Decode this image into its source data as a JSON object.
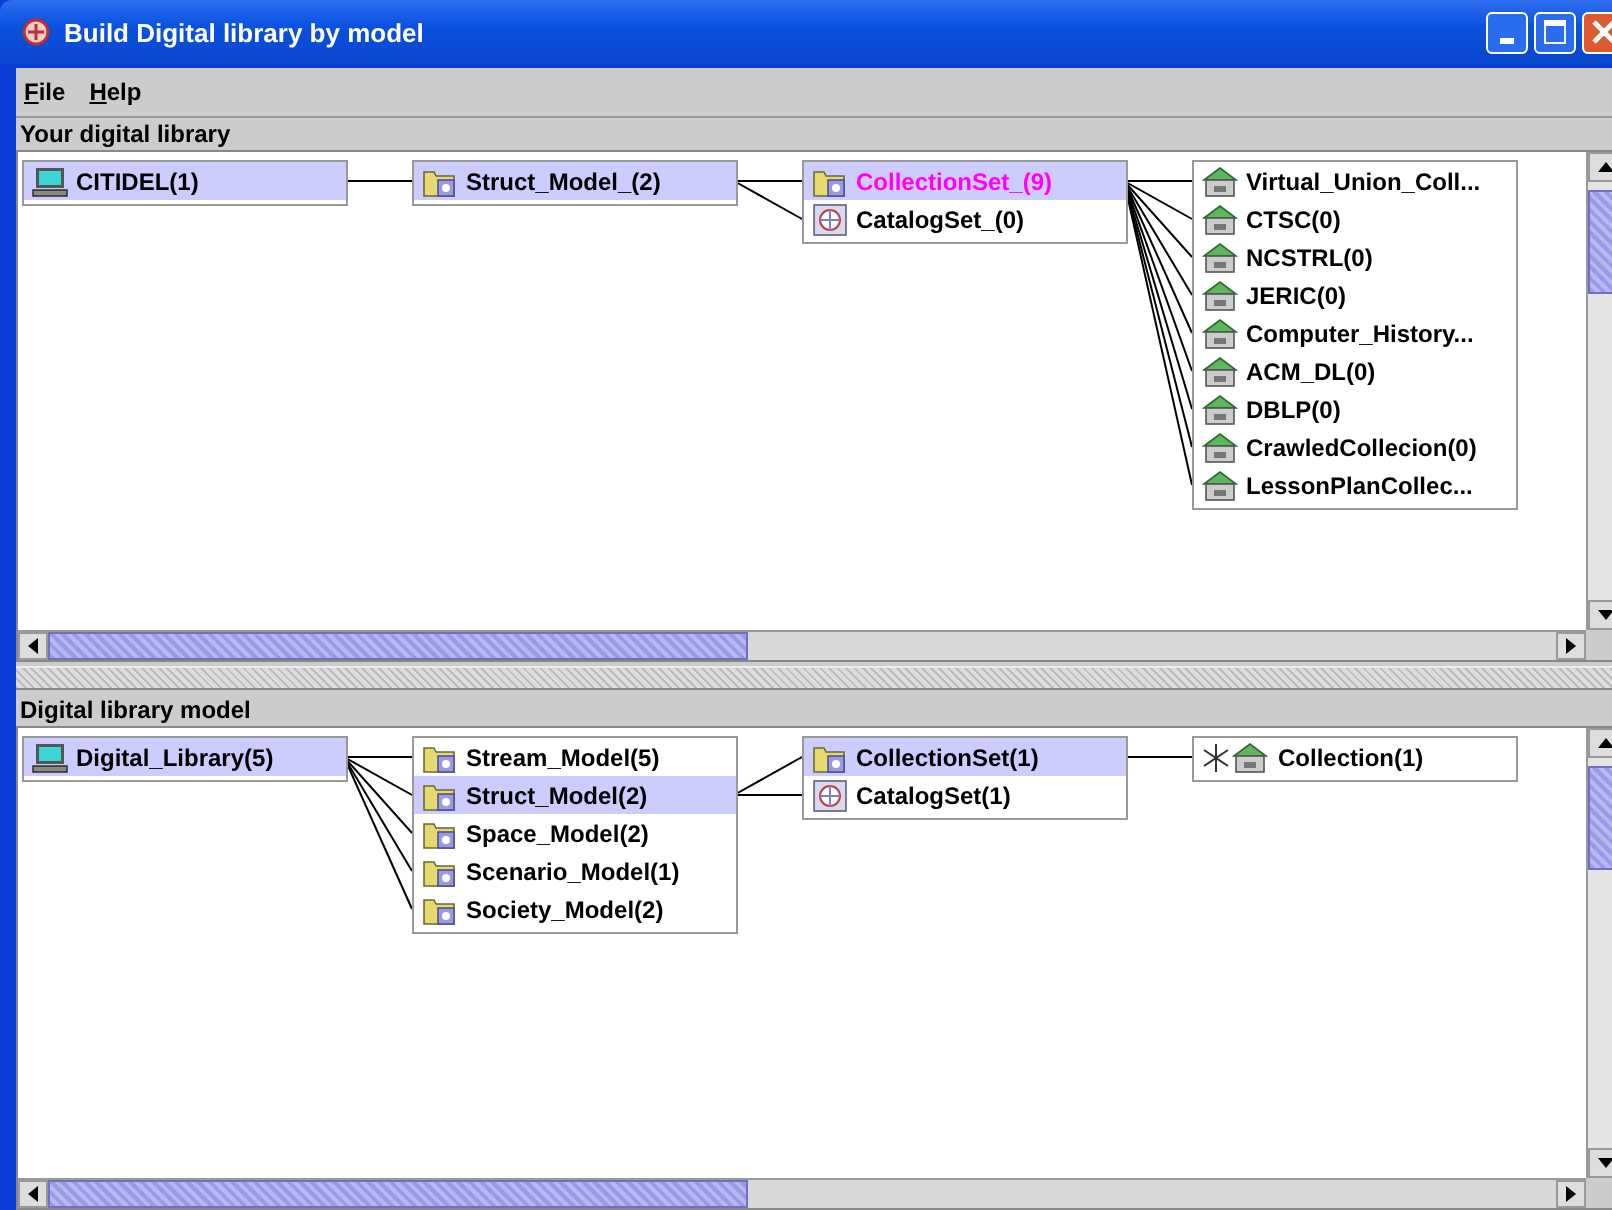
{
  "window": {
    "title": "Build Digital library by model"
  },
  "menu": [
    "File",
    "Help"
  ],
  "panels": [
    {
      "title": "Your digital library",
      "columns": [
        {
          "items": [
            {
              "label": "CITIDEL(1)",
              "kind": "computer",
              "selected": true,
              "marked": false
            }
          ]
        },
        {
          "items": [
            {
              "label": "Struct_Model_(2)",
              "kind": "model",
              "selected": true,
              "marked": false
            }
          ]
        },
        {
          "items": [
            {
              "label": "CollectionSet_(9)",
              "kind": "model",
              "selected": true,
              "marked": true
            },
            {
              "label": "CatalogSet_(0)",
              "kind": "catalog",
              "selected": false,
              "marked": false
            }
          ]
        },
        {
          "items": [
            {
              "label": "Virtual_Union_Coll...",
              "kind": "collection",
              "selected": false,
              "marked": false
            },
            {
              "label": "CTSC(0)",
              "kind": "collection",
              "selected": false,
              "marked": false
            },
            {
              "label": "NCSTRL(0)",
              "kind": "collection",
              "selected": false,
              "marked": false
            },
            {
              "label": "JERIC(0)",
              "kind": "collection",
              "selected": false,
              "marked": false
            },
            {
              "label": "Computer_History...",
              "kind": "collection",
              "selected": false,
              "marked": false
            },
            {
              "label": "ACM_DL(0)",
              "kind": "collection",
              "selected": false,
              "marked": false
            },
            {
              "label": "DBLP(0)",
              "kind": "collection",
              "selected": false,
              "marked": false
            },
            {
              "label": "CrawledCollecion(0)",
              "kind": "collection",
              "selected": false,
              "marked": false
            },
            {
              "label": "LessonPlanCollec...",
              "kind": "collection",
              "selected": false,
              "marked": false
            }
          ]
        }
      ]
    },
    {
      "title": "Digital library model",
      "columns": [
        {
          "items": [
            {
              "label": "Digital_Library(5)",
              "kind": "computer",
              "selected": true,
              "marked": false
            }
          ]
        },
        {
          "items": [
            {
              "label": "Stream_Model(5)",
              "kind": "model",
              "selected": false,
              "marked": false
            },
            {
              "label": "Struct_Model(2)",
              "kind": "model",
              "selected": true,
              "marked": false
            },
            {
              "label": "Space_Model(2)",
              "kind": "model",
              "selected": false,
              "marked": false
            },
            {
              "label": "Scenario_Model(1)",
              "kind": "model",
              "selected": false,
              "marked": false
            },
            {
              "label": "Society_Model(2)",
              "kind": "model",
              "selected": false,
              "marked": false
            }
          ]
        },
        {
          "items": [
            {
              "label": "CollectionSet(1)",
              "kind": "model",
              "selected": true,
              "marked": false
            },
            {
              "label": "CatalogSet(1)",
              "kind": "catalog",
              "selected": false,
              "marked": false
            }
          ]
        },
        {
          "items": [
            {
              "label": "Collection(1)",
              "kind": "star-collection",
              "selected": false,
              "marked": false
            }
          ]
        }
      ]
    }
  ]
}
